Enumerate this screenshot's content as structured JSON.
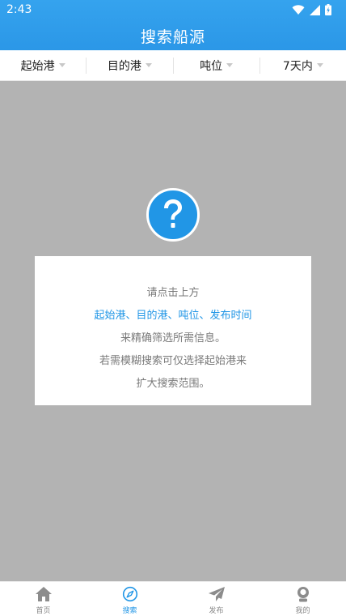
{
  "status_bar": {
    "time": "2:43"
  },
  "header": {
    "title": "搜索船源"
  },
  "filters": [
    {
      "label": "起始港"
    },
    {
      "label": "目的港"
    },
    {
      "label": "吨位"
    },
    {
      "label": "7天内"
    }
  ],
  "dialog": {
    "line1": "请点击上方",
    "line2": "起始港、目的港、吨位、发布时间",
    "line3": "来精确筛选所需信息。",
    "line4": "若需模糊搜索可仅选择起始港来",
    "line5": "扩大搜索范围。"
  },
  "tabs": [
    {
      "label": "首页",
      "icon": "home-icon",
      "active": false
    },
    {
      "label": "搜索",
      "icon": "compass-icon",
      "active": true
    },
    {
      "label": "发布",
      "icon": "paper-plane-icon",
      "active": false
    },
    {
      "label": "我的",
      "icon": "user-icon",
      "active": false
    }
  ],
  "colors": {
    "accent": "#2196e6",
    "overlay": "#b3b3b3"
  }
}
